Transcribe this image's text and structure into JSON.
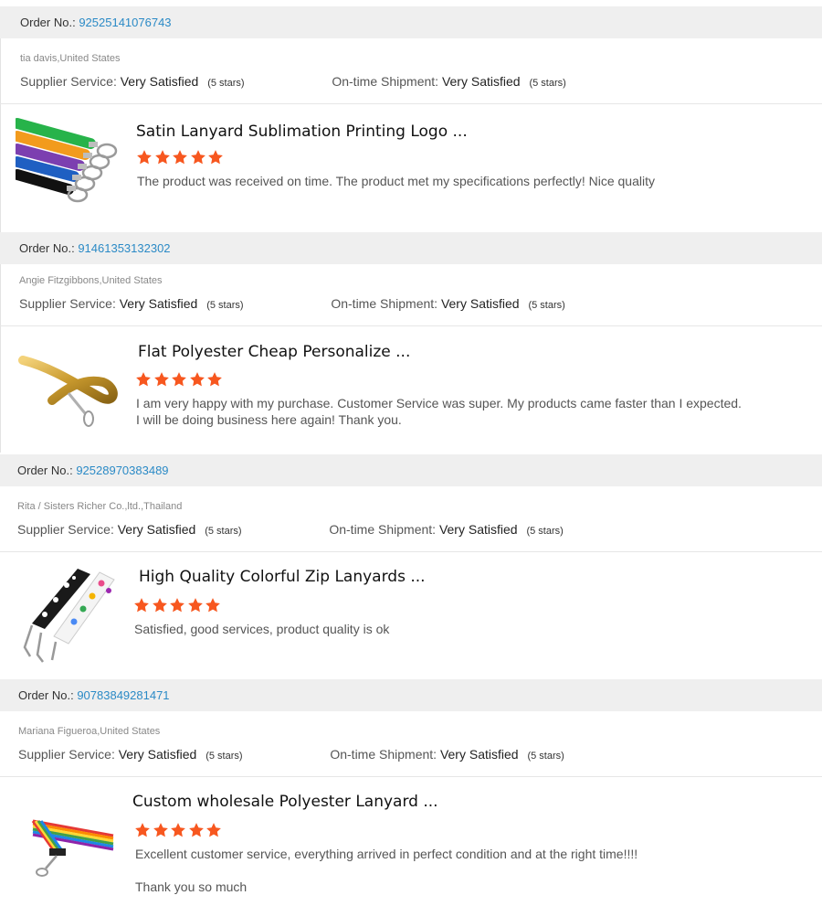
{
  "labels": {
    "order_no": "Order No.:",
    "supplier_service": "Supplier Service:",
    "ontime_shipment": "On-time Shipment:"
  },
  "colors": {
    "star": "#f7571f",
    "link": "#2b8ac6",
    "bar": "#efefef"
  },
  "reviews": [
    {
      "order_number": "92525141076743",
      "buyer": "tia davis,United States",
      "supplier_value": "Very Satisfied",
      "supplier_stars": "(5 stars)",
      "shipment_value": "Very Satisfied",
      "shipment_stars": "(5 stars)",
      "product_title": "Satin Lanyard Sublimation Printing Logo ...",
      "rating": 5,
      "comment_lines": [
        "The product was received on time. The product met my specifications perfectly!  Nice quality"
      ],
      "thumb_icon": "colorful-lanyards-icon"
    },
    {
      "order_number": "91461353132302",
      "buyer": "Angie Fitzgibbons,United States",
      "supplier_value": "Very Satisfied",
      "supplier_stars": "(5 stars)",
      "shipment_value": "Very Satisfied",
      "shipment_stars": "(5 stars)",
      "product_title": "Flat Polyester Cheap Personalize ...",
      "rating": 5,
      "comment_lines": [
        "I am very happy with my purchase. Customer Service was super. My products came faster than I expected.",
        "I will be doing business here again! Thank you."
      ],
      "thumb_icon": "gold-lanyard-icon"
    },
    {
      "order_number": "92528970383489",
      "buyer": "Rita / Sisters Richer Co.,ltd.,Thailand",
      "supplier_value": "Very Satisfied",
      "supplier_stars": "(5 stars)",
      "shipment_value": "Very Satisfied",
      "shipment_stars": "(5 stars)",
      "product_title": "High Quality Colorful Zip Lanyards ...",
      "rating": 5,
      "comment_lines": [
        "Satisfied, good services, product quality is ok"
      ],
      "thumb_icon": "paw-print-lanyards-icon"
    },
    {
      "order_number": "90783849281471",
      "buyer": "Mariana Figueroa,United States",
      "supplier_value": "Very Satisfied",
      "supplier_stars": "(5 stars)",
      "shipment_value": "Very Satisfied",
      "shipment_stars": "(5 stars)",
      "product_title": "Custom wholesale Polyester Lanyard ...",
      "rating": 5,
      "comment_lines": [
        "Excellent customer service, everything arrived in perfect condition and at the right time!!!!",
        "",
        "Thank you so much"
      ],
      "thumb_icon": "rainbow-lanyard-icon"
    }
  ]
}
